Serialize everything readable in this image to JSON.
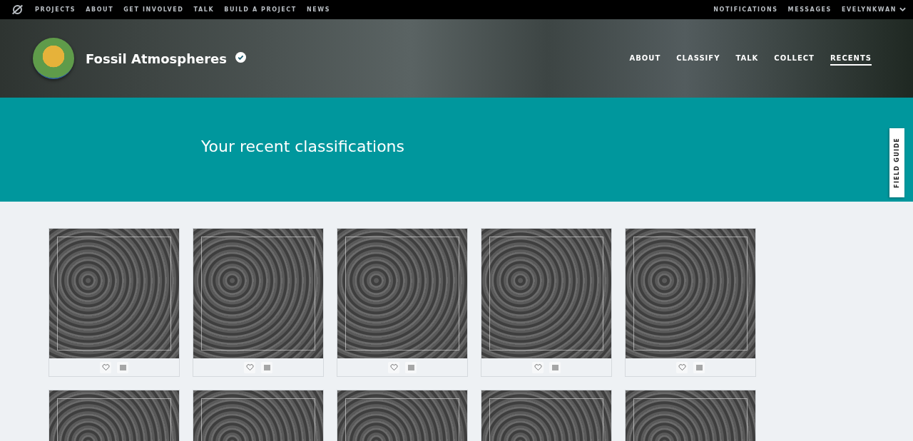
{
  "top_nav": {
    "links": [
      {
        "label": "PROJECTS"
      },
      {
        "label": "ABOUT"
      },
      {
        "label": "GET INVOLVED"
      },
      {
        "label": "TALK"
      },
      {
        "label": "BUILD A PROJECT"
      },
      {
        "label": "NEWS"
      }
    ],
    "right_links": [
      {
        "label": "NOTIFICATIONS"
      },
      {
        "label": "MESSAGES"
      }
    ],
    "user": "EVELYNKWAN"
  },
  "project": {
    "title": "Fossil Atmospheres",
    "verified": true,
    "tabs": [
      {
        "label": "ABOUT",
        "selected": false
      },
      {
        "label": "CLASSIFY",
        "selected": false
      },
      {
        "label": "TALK",
        "selected": false
      },
      {
        "label": "COLLECT",
        "selected": false
      },
      {
        "label": "RECENTS",
        "selected": true
      }
    ]
  },
  "banner": {
    "title": "Your recent classifications"
  },
  "field_guide": {
    "label": "FIELD GUIDE"
  },
  "classifications": [
    {
      "kind": "card",
      "favorited": false
    },
    {
      "kind": "card",
      "favorited": false
    },
    {
      "kind": "card",
      "favorited": false
    },
    {
      "kind": "card",
      "favorited": false
    },
    {
      "kind": "card",
      "favorited": false
    },
    {
      "kind": "thumbnail"
    },
    {
      "kind": "thumbnail"
    },
    {
      "kind": "thumbnail"
    },
    {
      "kind": "thumbnail"
    },
    {
      "kind": "thumbnail"
    }
  ]
}
